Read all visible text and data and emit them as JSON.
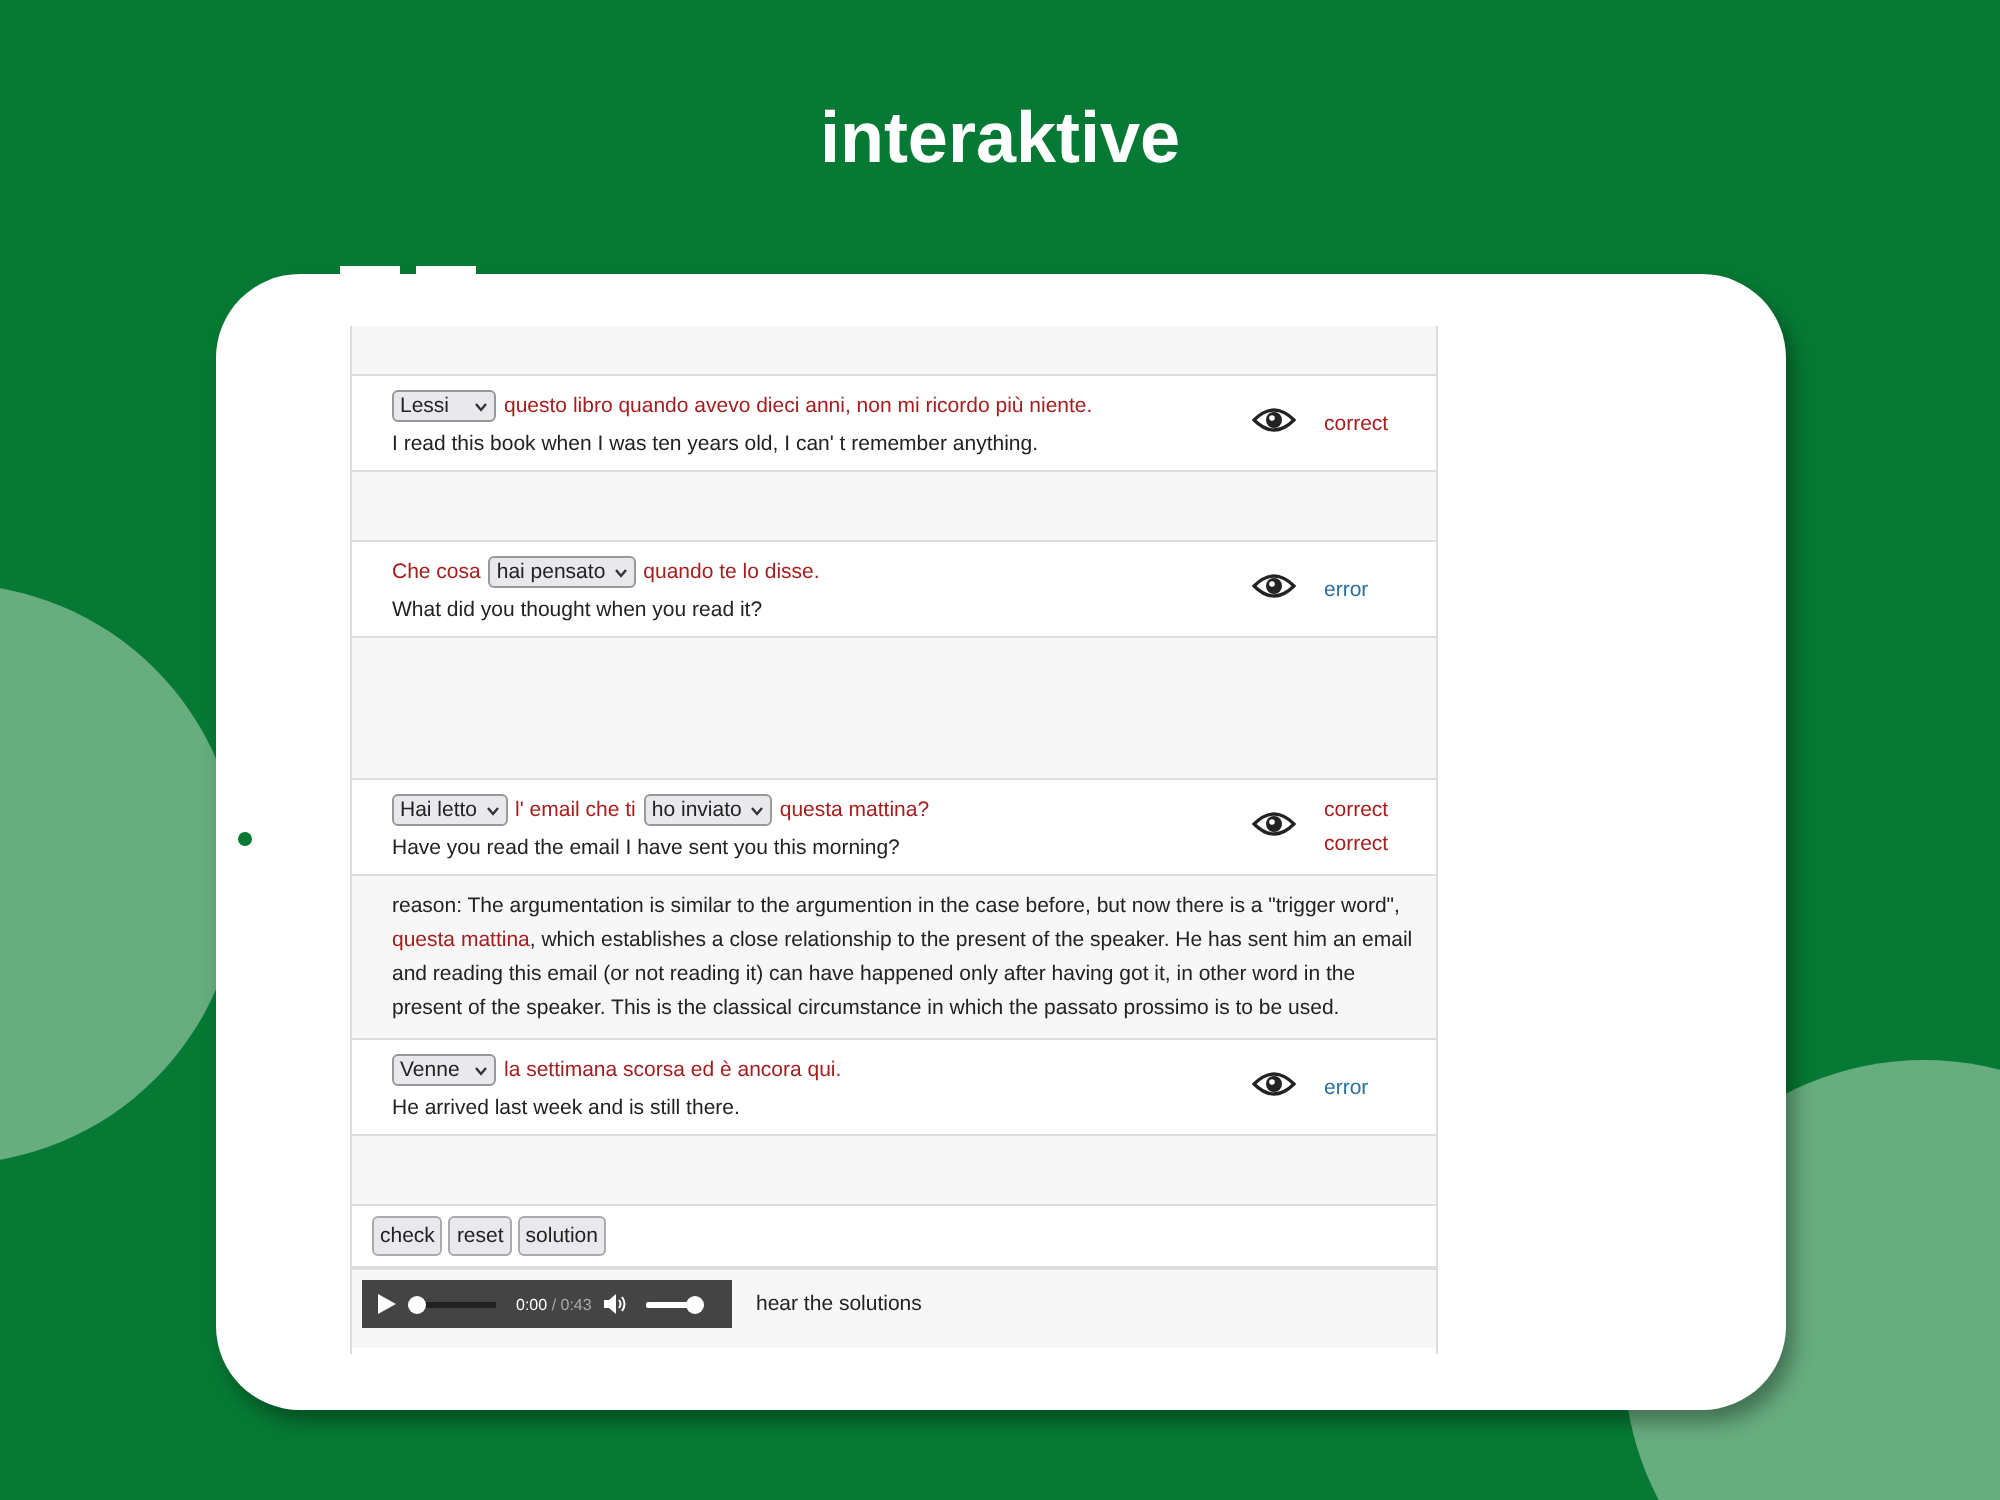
{
  "header": {
    "title": "interaktive"
  },
  "exercises": [
    {
      "segments": [
        {
          "kind": "select",
          "value": "Lessi"
        },
        {
          "kind": "text",
          "text": "questo libro quando avevo dieci anni, non mi ricordo più niente."
        }
      ],
      "translation": "I read this book when I was ten years old, I can' t remember anything.",
      "results": [
        {
          "kind": "correct",
          "text": "correct"
        }
      ]
    },
    {
      "segments": [
        {
          "kind": "text",
          "text": "Che cosa"
        },
        {
          "kind": "select",
          "value": "hai pensato"
        },
        {
          "kind": "text",
          "text": "quando te lo disse."
        }
      ],
      "translation": "What did you thought when you read it?",
      "results": [
        {
          "kind": "error",
          "text": "error"
        }
      ]
    },
    {
      "segments": [
        {
          "kind": "select",
          "value": "Hai letto"
        },
        {
          "kind": "text",
          "text": "l' email che ti"
        },
        {
          "kind": "select",
          "value": "ho inviato"
        },
        {
          "kind": "text",
          "text": "questa mattina?"
        }
      ],
      "translation": "Have you read the email I have sent you this morning?",
      "results": [
        {
          "kind": "correct",
          "text": "correct"
        },
        {
          "kind": "correct",
          "text": "correct"
        }
      ],
      "reason": [
        {
          "highlight": false,
          "text": "reason: The argumentation is similar to the argumention in the case before, but now there is a \"trigger word\", "
        },
        {
          "highlight": true,
          "text": "questa mattina"
        },
        {
          "highlight": false,
          "text": ", which establishes a close relationship to the present of the speaker. He has sent him an email and reading this email (or not reading it) can have happened only after having got it, in other word in the present of the speaker. This is the classical circumstance in which the passato prossimo is to be used."
        }
      ]
    },
    {
      "segments": [
        {
          "kind": "select",
          "value": "Venne"
        },
        {
          "kind": "text",
          "text": "la settimana scorsa ed è ancora qui."
        }
      ],
      "translation": "He arrived last week and is still there.",
      "results": [
        {
          "kind": "error",
          "text": "error"
        }
      ]
    }
  ],
  "buttons": [
    "check",
    "reset",
    "solution"
  ],
  "audio": {
    "time": "0:00",
    "duration": "/ 0:43",
    "progress": {
      "level": 0
    },
    "volume": {
      "level": 1
    },
    "label": "hear the solutions"
  }
}
